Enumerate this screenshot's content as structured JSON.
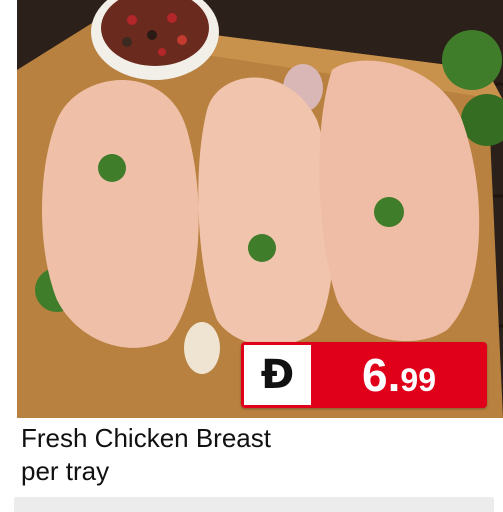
{
  "product": {
    "title_line1": "Fresh Chicken Breast",
    "title_line2": "per tray"
  },
  "price": {
    "currency_symbol": "Đ",
    "whole": "6.",
    "fraction": "99"
  },
  "colors": {
    "accent": "#e0001a"
  }
}
